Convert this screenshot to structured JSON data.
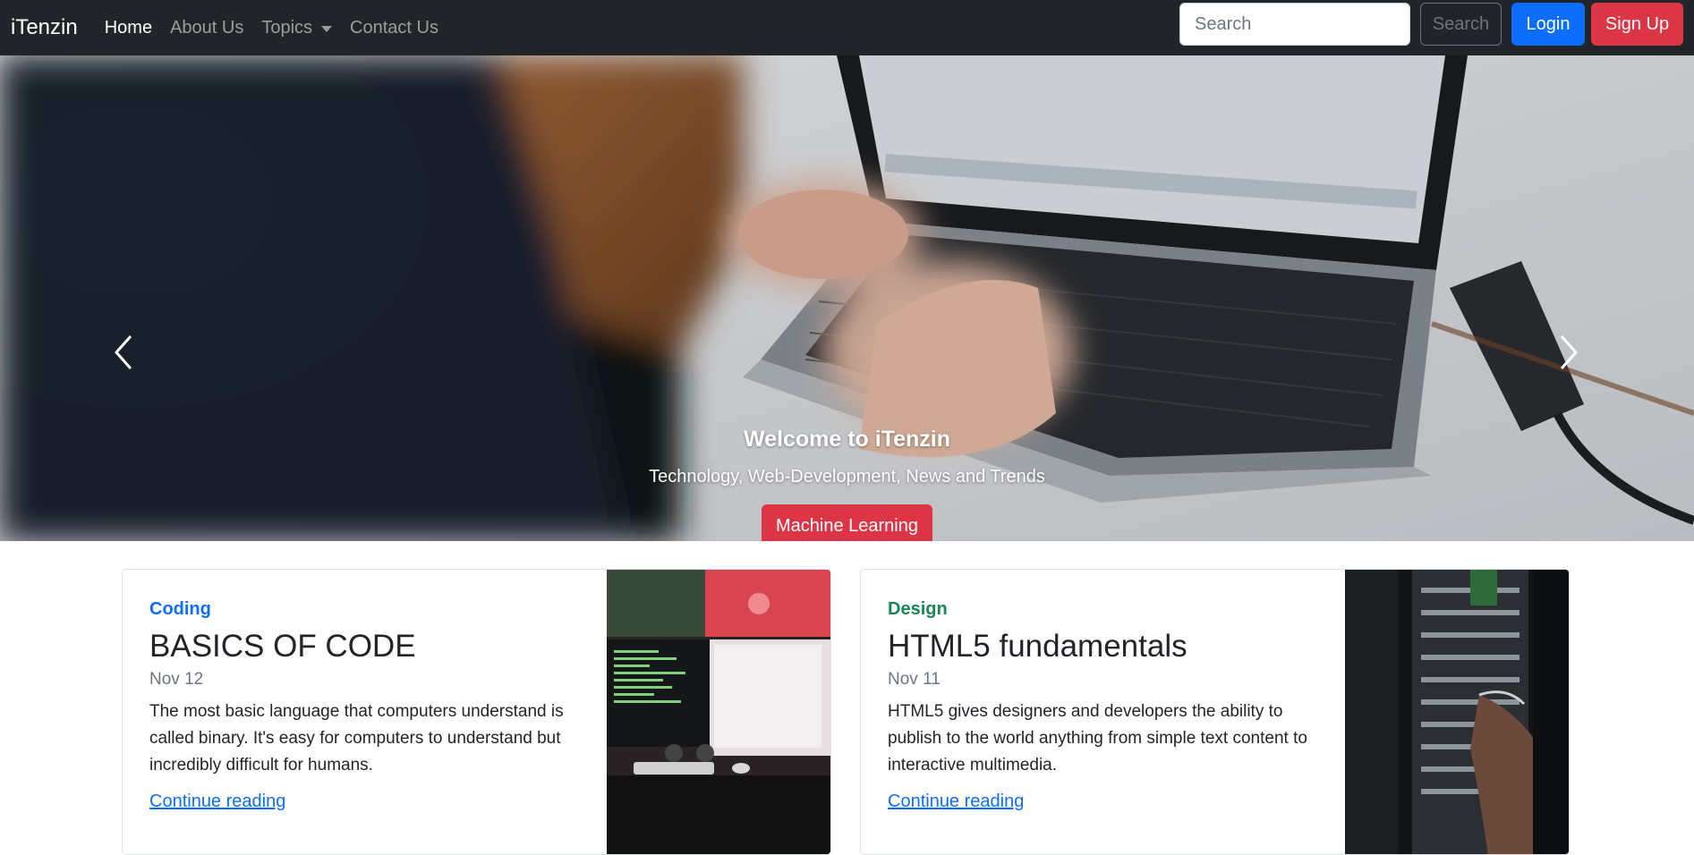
{
  "navbar": {
    "brand": "iTenzin",
    "links": [
      "Home",
      "About Us",
      "Topics",
      "Contact Us"
    ],
    "search_placeholder": "Search",
    "search_button": "Search",
    "login": "Login",
    "signup": "Sign Up"
  },
  "hero": {
    "title": "Welcome to iTenzin",
    "subtitle": "Technology, Web-Development, News and Trends",
    "button": "Machine Learning",
    "slide_count": 3,
    "active_slide": 1
  },
  "cards": [
    {
      "category": "Coding",
      "title": "BASICS OF CODE",
      "date": "Nov 12",
      "text": "The most basic language that computers understand is called binary. It's easy for computers to understand but incredibly difficult for humans.",
      "link": "Continue reading"
    },
    {
      "category": "Design",
      "title": "HTML5 fundamentals",
      "date": "Nov 11",
      "text": "HTML5 gives designers and developers the ability to publish to the world anything from simple text content to interactive multimedia.",
      "link": "Continue reading"
    }
  ],
  "colors": {
    "navbar_bg": "#212529",
    "primary": "#0d6efd",
    "danger": "#dc3545",
    "success": "#198754"
  }
}
